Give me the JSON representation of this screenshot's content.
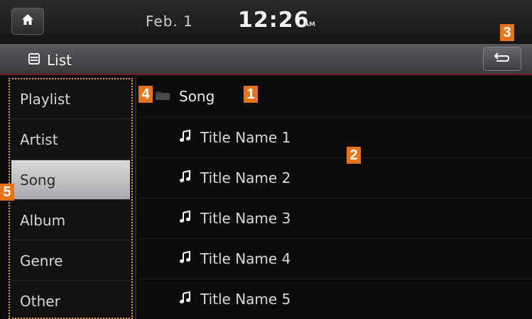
{
  "status_bar": {
    "home_icon": "home-icon",
    "date": "Feb. 1",
    "time": "12:26",
    "ampm": "AM"
  },
  "header": {
    "list_icon": "list-icon",
    "title": "List",
    "back_icon": "back-arrow-icon"
  },
  "categories": [
    {
      "label": "Playlist",
      "selected": false
    },
    {
      "label": "Artist",
      "selected": false
    },
    {
      "label": "Song",
      "selected": true
    },
    {
      "label": "Album",
      "selected": false
    },
    {
      "label": "Genre",
      "selected": false
    },
    {
      "label": "Other",
      "selected": false
    }
  ],
  "folder": {
    "icon": "folder-icon",
    "label": "Song"
  },
  "songs": [
    {
      "icon": "music-note-icon",
      "title": "Title Name 1"
    },
    {
      "icon": "music-note-icon",
      "title": "Title Name 2"
    },
    {
      "icon": "music-note-icon",
      "title": "Title Name 3"
    },
    {
      "icon": "music-note-icon",
      "title": "Title Name 4"
    },
    {
      "icon": "music-note-icon",
      "title": "Title Name 5"
    }
  ],
  "callouts": {
    "folder": "1",
    "list": "2",
    "back": "3",
    "folder_icon": "4",
    "categories": "5"
  },
  "colors": {
    "accent_orange": "#e8741a",
    "highlight_border": "#e7a43a",
    "header_line": "#7a1a24"
  }
}
